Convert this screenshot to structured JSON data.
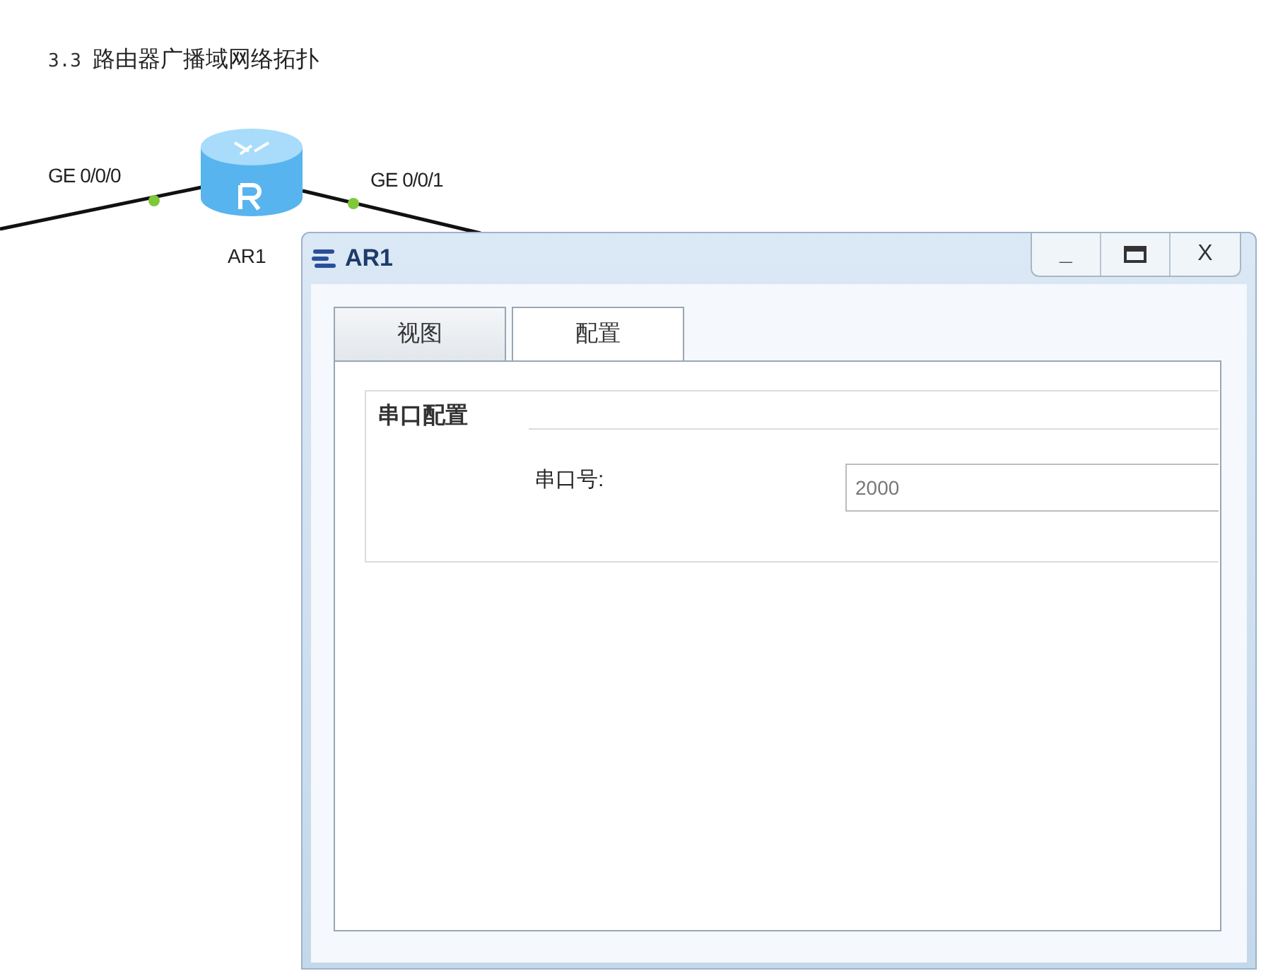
{
  "heading": {
    "number": "3.3",
    "title": "路由器广播域网络拓扑"
  },
  "topology": {
    "router": {
      "label": "AR1"
    },
    "ports": [
      {
        "label": "GE 0/0/0"
      },
      {
        "label": "GE 0/0/1"
      }
    ]
  },
  "window": {
    "title": "AR1",
    "controls": [
      "_",
      "X"
    ],
    "tabs": [
      {
        "label": "视图",
        "selected": false
      },
      {
        "label": "配置",
        "selected": true
      }
    ],
    "section": {
      "title": "串口配置",
      "field": {
        "label": "串口号:",
        "value": "2000"
      }
    }
  }
}
